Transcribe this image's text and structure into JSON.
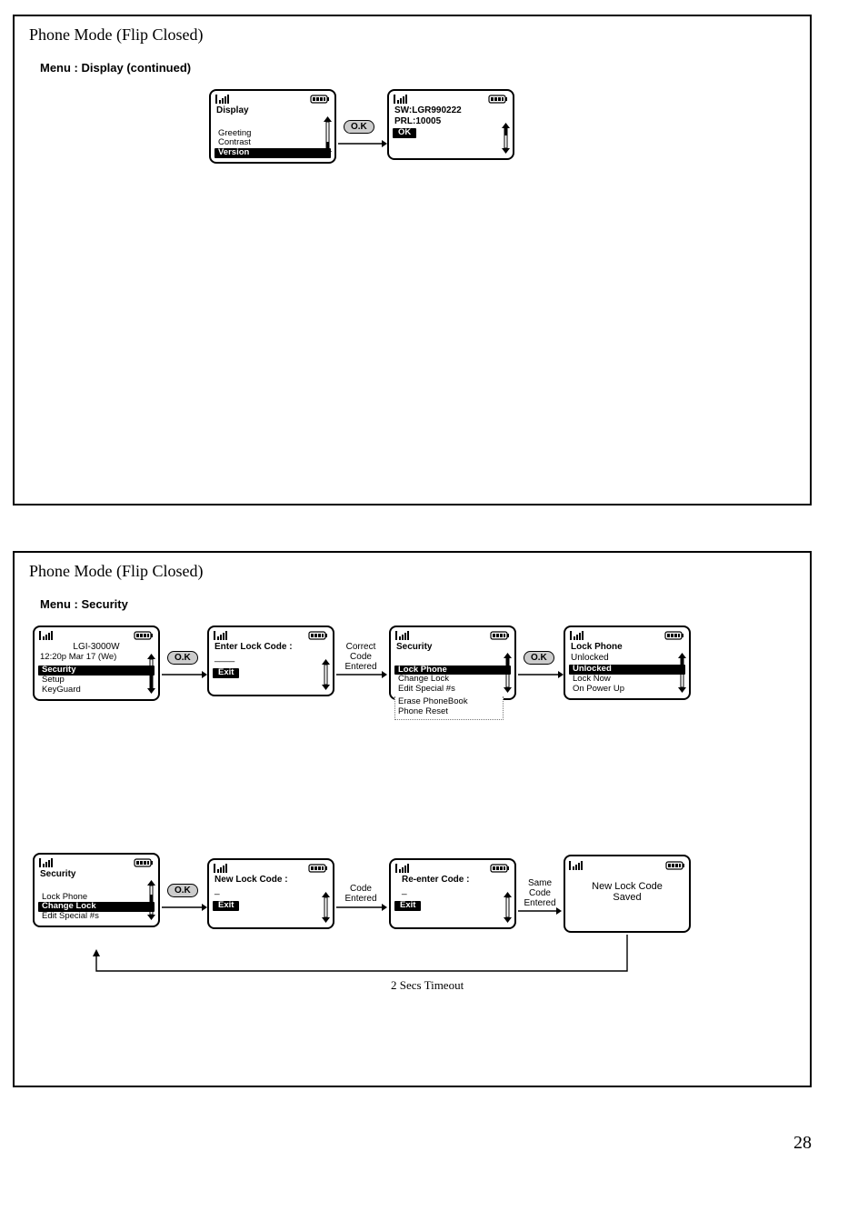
{
  "pageNumber": "28",
  "panel1": {
    "title": "Phone Mode (Flip Closed)",
    "heading": "Menu : Display (continued)",
    "screenA": {
      "header": "Display",
      "items": [
        "Greeting",
        "Contrast",
        "Version"
      ],
      "selectedIndex": 2
    },
    "pillAB": "O.K",
    "screenB": {
      "line1": "SW:LGR990222",
      "line2": "PRL:10005",
      "softkey": "OK"
    }
  },
  "panel2": {
    "title": "Phone Mode (Flip Closed)",
    "heading": "Menu : Security",
    "row1": {
      "s1": {
        "line1": "LGI-3000W",
        "line2": "12:20p Mar 17 (We)",
        "items": [
          "Security",
          "Setup",
          "KeyGuard"
        ],
        "selectedIndex": 0
      },
      "p12": "O.K",
      "s2": {
        "header": "Enter Lock Code :",
        "value": "____",
        "softkey": "Exit"
      },
      "l23": "Correct\nCode\nEntered",
      "s3": {
        "header": "Security",
        "items": [
          "Lock Phone",
          "Change Lock",
          "Edit Special #s"
        ],
        "extra": [
          "Erase PhoneBook",
          "Phone Reset"
        ],
        "selectedIndex": 0
      },
      "p34": "O.K",
      "s4": {
        "header": "Lock Phone",
        "sub": "Unlocked",
        "items": [
          "Unlocked",
          "Lock Now",
          "On Power Up"
        ],
        "selectedIndex": 0
      }
    },
    "row2": {
      "s1": {
        "header": "Security",
        "items": [
          "Lock Phone",
          "Change Lock",
          "Edit Special #s"
        ],
        "selectedIndex": 1
      },
      "p12": "O.K",
      "s2": {
        "header": "New Lock Code :",
        "value": "_",
        "softkey": "Exit"
      },
      "l23": "Code\nEntered",
      "s3": {
        "header": "Re-enter Code :",
        "value": "_",
        "softkey": "Exit"
      },
      "l34": "Same\nCode\nEntered",
      "s4": {
        "line1": "New Lock Code",
        "line2": "Saved"
      },
      "timeout": "2 Secs Timeout"
    }
  }
}
